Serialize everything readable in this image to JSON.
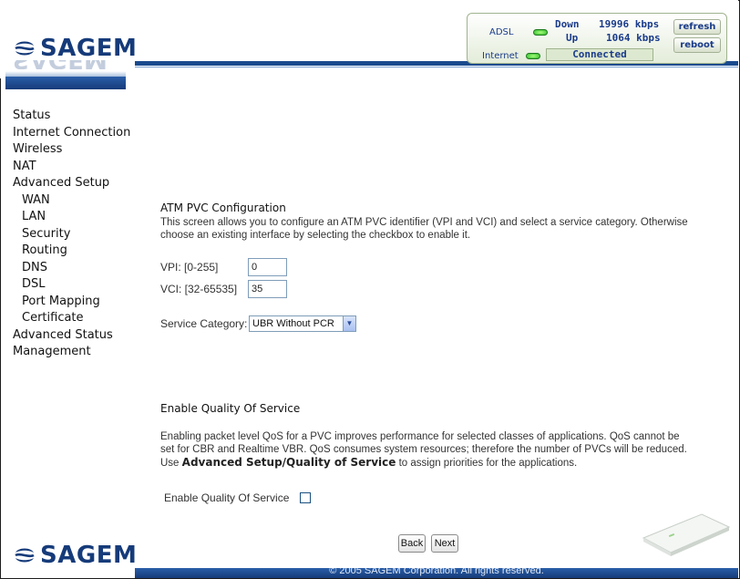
{
  "brand": {
    "name": "SAGEM"
  },
  "status": {
    "adsl_label": "ADSL",
    "internet_label": "Internet",
    "down_label": "Down",
    "up_label": "Up",
    "down_rate": "19996 kbps",
    "up_rate": "1064 kbps",
    "connection": "Connected",
    "refresh_label": "refresh",
    "reboot_label": "reboot",
    "led_color": "#2db82d"
  },
  "nav": {
    "items": [
      {
        "label": "Status"
      },
      {
        "label": "Internet Connection"
      },
      {
        "label": "Wireless"
      },
      {
        "label": "NAT"
      },
      {
        "label": "Advanced Setup"
      },
      {
        "label": "WAN"
      },
      {
        "label": "LAN"
      },
      {
        "label": "Security"
      },
      {
        "label": "Routing"
      },
      {
        "label": "DNS"
      },
      {
        "label": "DSL"
      },
      {
        "label": "Port Mapping"
      },
      {
        "label": "Certificate"
      },
      {
        "label": "Advanced Status"
      },
      {
        "label": "Management"
      }
    ]
  },
  "atm": {
    "title": "ATM PVC Configuration",
    "desc": "This screen allows you to configure an ATM PVC identifier (VPI and VCI) and select a service category. Otherwise choose an existing interface by selecting the checkbox to enable it.",
    "vpi_label": "VPI: [0-255]",
    "vpi_value": "0",
    "vci_label": "VCI: [32-65535]",
    "vci_value": "35",
    "service_label": "Service Category:",
    "service_value": "UBR Without PCR"
  },
  "qos": {
    "title": "Enable Quality Of Service",
    "desc_pre": "Enabling packet level QoS for a PVC improves performance for selected classes of applications.  QoS cannot be set for CBR and Realtime VBR.  QoS consumes system resources; therefore the number of PVCs will be reduced. Use ",
    "desc_bold": "Advanced Setup/Quality of Service",
    "desc_post": " to assign priorities for the applications.",
    "checkbox_label": "Enable Quality Of Service",
    "checked": false
  },
  "buttons": {
    "back": "Back",
    "next": "Next"
  },
  "footer": {
    "copyright": "© 2005 SAGEM Corporation. All rights reserved."
  },
  "colors": {
    "brand_blue": "#163b7a",
    "bar_blue": "#1a4a8e"
  }
}
